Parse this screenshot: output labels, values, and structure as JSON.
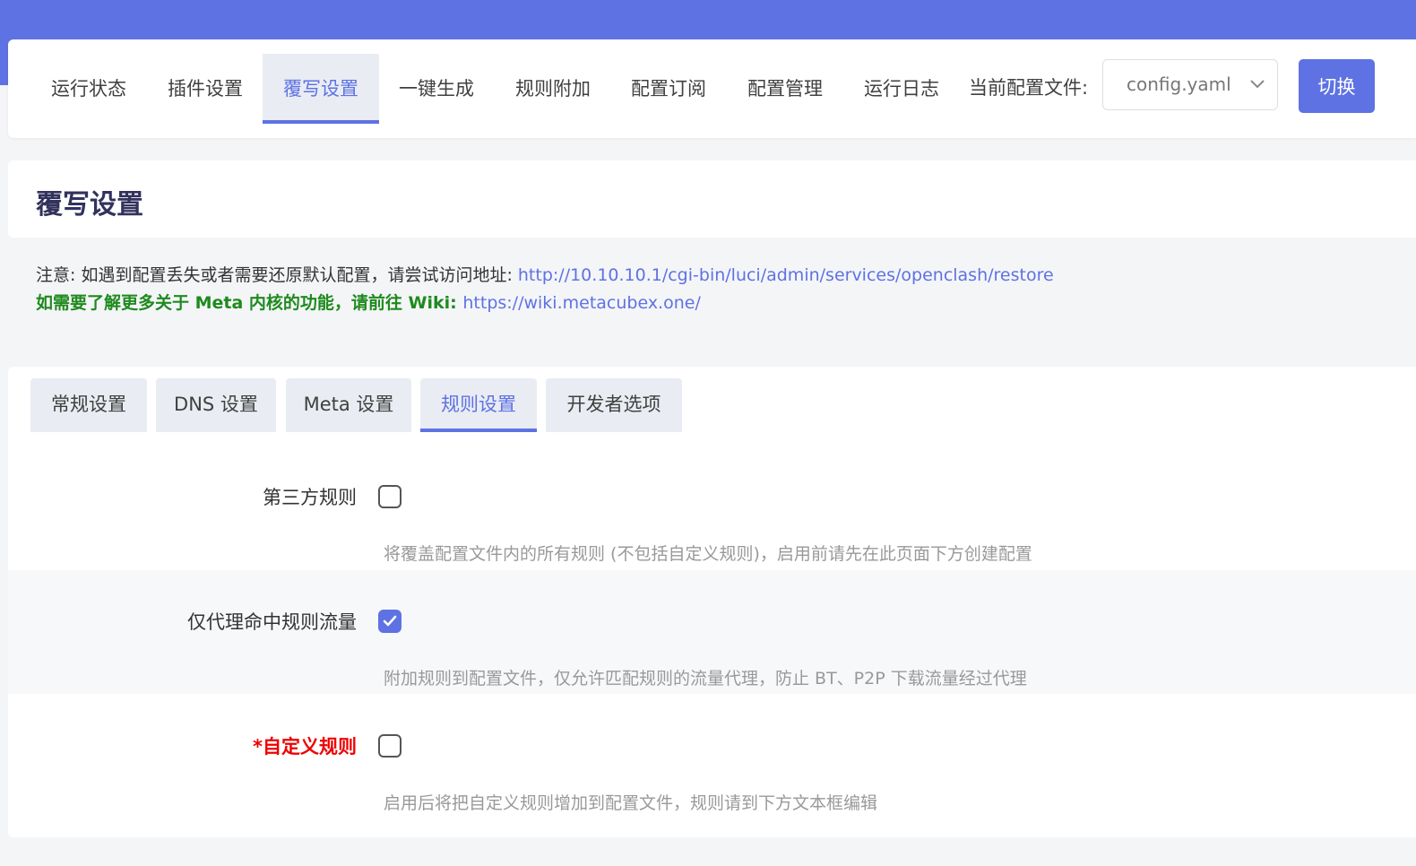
{
  "nav": {
    "tabs": [
      {
        "label": "运行状态"
      },
      {
        "label": "插件设置"
      },
      {
        "label": "覆写设置",
        "active": true
      },
      {
        "label": "一键生成"
      },
      {
        "label": "规则附加"
      },
      {
        "label": "配置订阅"
      },
      {
        "label": "配置管理"
      },
      {
        "label": "运行日志"
      }
    ],
    "config_label": "当前配置文件:",
    "config_value": "config.yaml",
    "switch_label": "切换"
  },
  "page": {
    "title": "覆写设置",
    "note_prefix": "注意: 如遇到配置丢失或者需要还原默认配置，请尝试访问地址: ",
    "note_link": "http://10.10.10.1/cgi-bin/luci/admin/services/openclash/restore",
    "wiki_prefix": "如需要了解更多关于 Meta 内核的功能，请前往 Wiki: ",
    "wiki_link": "https://wiki.metacubex.one/"
  },
  "subtabs": [
    {
      "label": "常规设置"
    },
    {
      "label": "DNS 设置"
    },
    {
      "label": "Meta 设置"
    },
    {
      "label": "规则设置",
      "active": true
    },
    {
      "label": "开发者选项"
    }
  ],
  "rows": [
    {
      "label": "第三方规则",
      "checked": false,
      "desc": "将覆盖配置文件内的所有规则 (不包括自定义规则)，启用前请先在此页面下方创建配置"
    },
    {
      "label": "仅代理命中规则流量",
      "checked": true,
      "desc": "附加规则到配置文件，仅允许匹配规则的流量代理，防止 BT、P2P 下载流量经过代理"
    },
    {
      "label": "*自定义规则",
      "checked": false,
      "required": true,
      "desc": "启用后将把自定义规则增加到配置文件，规则请到下方文本框编辑"
    }
  ],
  "colors": {
    "accent": "#5e72e4",
    "required": "#ee0000",
    "note_green": "#1e8a1e"
  }
}
